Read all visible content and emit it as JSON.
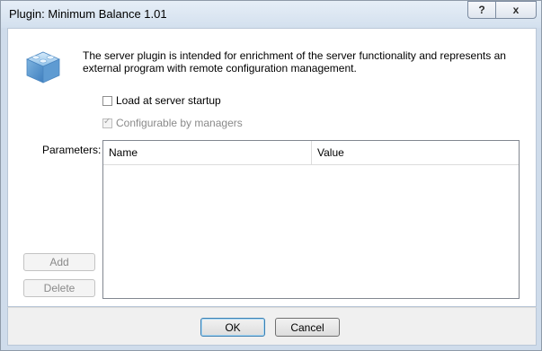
{
  "window": {
    "title": "Plugin: Minimum Balance 1.01",
    "help_glyph": "?",
    "close_glyph": "x"
  },
  "plugin": {
    "icon": "plugin-cubes-icon",
    "description": "The server plugin is intended for enrichment of the server functionality and represents an external program with remote configuration management."
  },
  "options": {
    "load_at_startup": {
      "label": "Load at server startup",
      "checked": false
    },
    "configurable_by_managers": {
      "label": "Configurable by managers",
      "checked": true,
      "disabled": true
    }
  },
  "parameters": {
    "label": "Parameters:",
    "columns": [
      "Name",
      "Value"
    ],
    "rows": []
  },
  "actions": {
    "add_label": "Add",
    "delete_label": "Delete"
  },
  "footer": {
    "ok_label": "OK",
    "cancel_label": "Cancel"
  },
  "colors": {
    "frame": "#cfdceb",
    "client": "#ffffff",
    "footer": "#f0f0f0",
    "icon_blue": "#6fa8d8"
  }
}
